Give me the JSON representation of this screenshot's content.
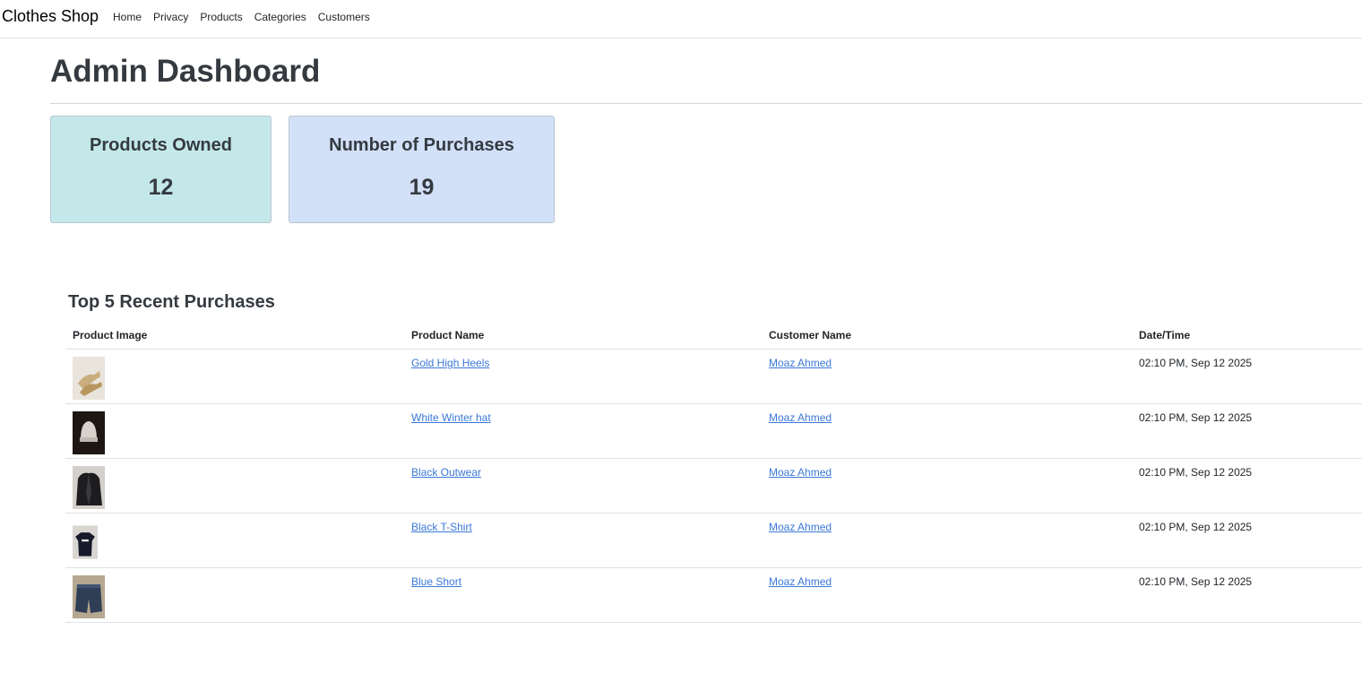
{
  "nav": {
    "brand": "Clothes Shop",
    "links": [
      "Home",
      "Privacy",
      "Products",
      "Categories",
      "Customers"
    ]
  },
  "page": {
    "title": "Admin Dashboard"
  },
  "stats": {
    "products_owned": {
      "label": "Products Owned",
      "value": "12",
      "color": "#c4e8ea"
    },
    "purchases": {
      "label": "Number of Purchases",
      "value": "19",
      "color": "#d2e0f8"
    }
  },
  "recent": {
    "title": "Top 5 Recent Purchases",
    "columns": [
      "Product Image",
      "Product Name",
      "Customer Name",
      "Date/Time"
    ],
    "rows": [
      {
        "image": "gold-high-heels-photo",
        "product": "Gold High Heels",
        "customer": "Moaz Ahmed",
        "datetime": "02:10 PM, Sep 12 2025"
      },
      {
        "image": "white-winter-hat-photo",
        "product": "White Winter hat",
        "customer": "Moaz Ahmed",
        "datetime": "02:10 PM, Sep 12 2025"
      },
      {
        "image": "black-outwear-photo",
        "product": "Black Outwear",
        "customer": "Moaz Ahmed",
        "datetime": "02:10 PM, Sep 12 2025"
      },
      {
        "image": "black-tshirt-photo",
        "product": "Black T-Shirt",
        "customer": "Moaz Ahmed",
        "datetime": "02:10 PM, Sep 12 2025"
      },
      {
        "image": "blue-short-photo",
        "product": "Blue Short",
        "customer": "Moaz Ahmed",
        "datetime": "02:10 PM, Sep 12 2025"
      }
    ]
  },
  "colors": {
    "link": "#3a78d8",
    "text": "#343a40"
  }
}
